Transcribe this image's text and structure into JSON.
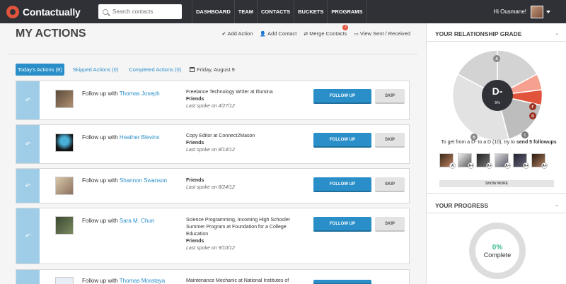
{
  "brand": {
    "name": "Contactually"
  },
  "search": {
    "placeholder": "Search contacts"
  },
  "nav": [
    "DASHBOARD",
    "TEAM",
    "CONTACTS",
    "BUCKETS",
    "PROGRAMS"
  ],
  "user": {
    "greeting": "Hi Ousmane!"
  },
  "page": {
    "title": "MY ACTIONS"
  },
  "toolbar": {
    "add_action": "Add Action",
    "add_contact": "Add Contact",
    "merge_contacts": "Merge Contacts",
    "merge_badge": "2",
    "view_sent": "View Sent / Received"
  },
  "tabs": {
    "today": "Today's Actions (8)",
    "skipped": "Skipped Actions (0)",
    "completed": "Completed Actions (0)",
    "date": "Friday, August 9"
  },
  "rows": [
    {
      "prefix": "Follow up with",
      "name": "Thomas Joseph",
      "title": "Freelance Technology Writer at Illumina",
      "group": "Friends",
      "last": "Last spoke on 4/27/12"
    },
    {
      "prefix": "Follow up with",
      "name": "Heather Blevins",
      "title": "Copy Editor at Connect2Mason",
      "group": "Friends",
      "last": "Last spoke on 8/14/12"
    },
    {
      "prefix": "Follow up with",
      "name": "Shannon Swanson",
      "title": "",
      "group": "Friends",
      "last": "Last spoke on 8/24/12"
    },
    {
      "prefix": "Follow up with",
      "name": "Sara M. Chun",
      "title": "Science Programming, Incoming High Schooler Summer Program at Foundation for a College Education",
      "group": "Friends",
      "last": "Last spoke on 9/10/12"
    },
    {
      "prefix": "Follow up with",
      "name": "Thomas Morataya",
      "title": "Maintenance Mechanic at National Institutes of",
      "group": "",
      "last": ""
    }
  ],
  "buttons": {
    "follow_up": "FOLLOW UP",
    "skip": "SKIP"
  },
  "sidebar": {
    "grade_title": "YOUR RELATIONSHIP GRADE",
    "grade": "D-",
    "grade_pct": "5%",
    "segments": [
      "A",
      "B",
      "C",
      "D",
      "F"
    ],
    "grade_hint_pre": "To get from a D- to a D (10), try to ",
    "grade_hint_bold": "send 5 followups",
    "mini_grades": [
      "A",
      "A+",
      "A+",
      "A+",
      "A+",
      "A+"
    ],
    "show_more": "SHOW MORE",
    "progress_title": "YOUR PROGRESS",
    "progress_pct": "0%",
    "progress_label": "Complete"
  },
  "colors": {
    "nav_bg": "#2f3137",
    "accent": "#2a8fc9",
    "brand": "#e2533c",
    "progress": "#3dbb8b"
  }
}
